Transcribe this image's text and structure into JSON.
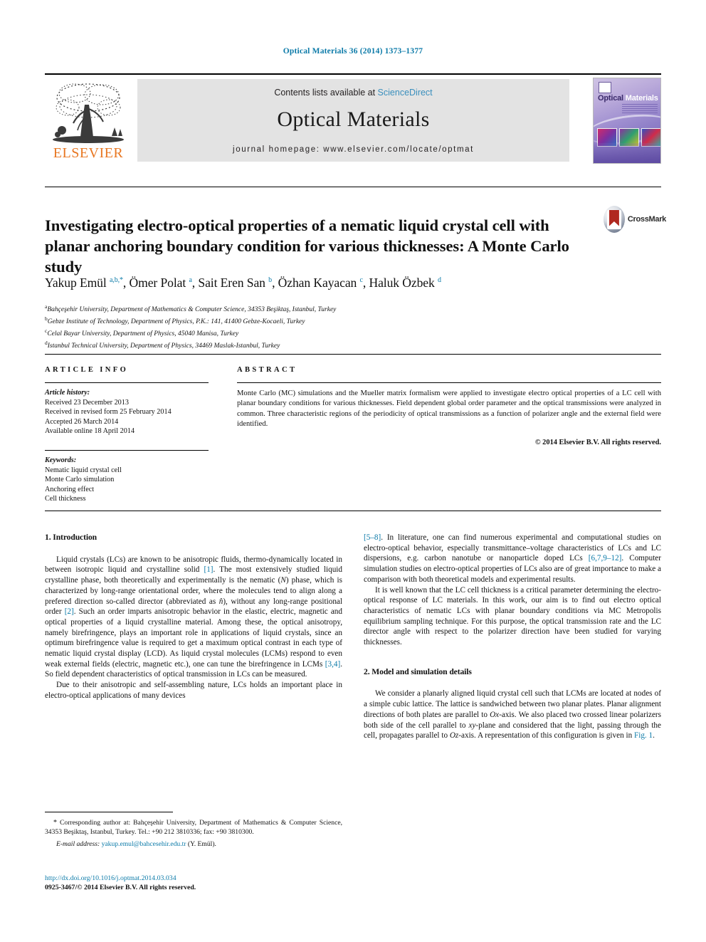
{
  "running_head": "Optical Materials 36 (2014) 1373–1377",
  "masthead": {
    "publisher_name": "ELSEVIER",
    "contents_prefix": "Contents lists available at ",
    "contents_link": "ScienceDirect",
    "journal_title": "Optical Materials",
    "homepage": "journal homepage: www.elsevier.com/locate/optmat",
    "cover_title_a": "Optical",
    "cover_title_b": "Materials"
  },
  "crossmark": {
    "label": "CrossMark"
  },
  "article": {
    "title": "Investigating electro-optical properties of a nematic liquid crystal cell with planar anchoring boundary condition for various thicknesses: A Monte Carlo study",
    "authors_html": "Yakup Emül <sup>a,b,*</sup>, Ömer Polat <sup>a</sup>, Sait Eren San <sup>b</sup>, Özhan Kayacan <sup>c</sup>, Haluk Özbek <sup>d</sup>",
    "affiliations": [
      "Bahçeşehir University, Department of Mathematics & Computer Science, 34353 Beşiktaş, Istanbul, Turkey",
      "Gebze Institute of Technology, Department of Physics, P.K.: 141, 41400 Gebze-Kocaeli, Turkey",
      "Celal Bayar University, Department of Physics, 45040 Manisa, Turkey",
      "Istanbul Technical University, Department of Physics, 34469 Maslak-Istanbul, Turkey"
    ],
    "affiliation_marks": [
      "a",
      "b",
      "c",
      "d"
    ]
  },
  "info": {
    "heading": "ARTICLE INFO",
    "history_title": "Article history:",
    "history": [
      "Received 23 December 2013",
      "Received in revised form 25 February 2014",
      "Accepted 26 March 2014",
      "Available online 18 April 2014"
    ],
    "keywords_title": "Keywords:",
    "keywords": [
      "Nematic liquid crystal cell",
      "Monte Carlo simulation",
      "Anchoring effect",
      "Cell thickness"
    ]
  },
  "abstract": {
    "heading": "ABSTRACT",
    "text": "Monte Carlo (MC) simulations and the Mueller matrix formalism were applied to investigate electro optical properties of a LC cell with planar boundary conditions for various thicknesses. Field dependent global order parameter and the optical transmissions were analyzed in common. Three characteristic regions of the periodicity of optical transmissions as a function of polarizer angle and the external field were identified.",
    "copyright": "© 2014 Elsevier B.V. All rights reserved."
  },
  "sections": {
    "intro_heading": "1. Introduction",
    "model_heading": "2. Model and simulation details"
  },
  "body": {
    "left": {
      "p1_a": "Liquid crystals (LCs) are known to be anisotropic fluids, thermo-dynamically located in between isotropic liquid and crystalline solid ",
      "p1_ref1": "[1]",
      "p1_b": ". The most extensively studied liquid crystalline phase, both theoretically and experimentally is the nematic (",
      "p1_n": "N",
      "p1_c": ") phase, which is characterized by long-range orientational order, where the molecules tend to align along a prefered direction so-called director (abbreviated as ",
      "p1_nhat": "n̂",
      "p1_d": "), without any long-range positional order ",
      "p1_ref2": "[2]",
      "p1_e": ". Such an order imparts anisotropic behavior in the elastic, electric, magnetic and optical properties of a liquid crystalline material. Among these, the optical anisotropy, namely birefringence, plays an important role in applications of liquid crystals, since an optimum birefringence value is required to get a maximum optical contrast in each type of nematic liquid crystal display (LCD). As liquid crystal molecules (LCMs) respond to even weak external fields (electric, magnetic etc.), one can tune the birefringence in LCMs ",
      "p1_ref3": "[3,4]",
      "p1_f": ". So field dependent characteristics of optical transmission in LCs can be measured.",
      "p2": "Due to their anisotropic and self-assembling nature, LCs holds an important place in electro-optical applications of many devices"
    },
    "right": {
      "p1_ref1": "[5–8]",
      "p1_a": ". In literature, one can find numerous experimental and computational studies on electro-optical behavior, especially transmittance–voltage characteristics of LCs and LC dispersions, e.g. carbon nanotube or nanoparticle doped LCs ",
      "p1_ref2": "[6,7,9–12]",
      "p1_b": ". Computer simulation studies on electro-optical properties of LCs also are of great importance to make a comparison with both theoretical models and experimental results.",
      "p2": "It is well known that the LC cell thickness is a critical parameter determining the electro-optical response of LC materials. In this work, our aim is to find out electro optical characteristics of nematic LCs with planar boundary conditions via MC Metropolis equilibrium sampling technique. For this purpose, the optical transmission rate and the LC director angle with respect to the polarizer direction have been studied for varying thicknesses.",
      "p3_a": "We consider a planarly aligned liquid crystal cell such that LCMs are located at nodes of a simple cubic lattice. The lattice is sandwiched between two planar plates. Planar alignment directions of both plates are parallel to ",
      "p3_ox": "Ox",
      "p3_b": "-axis. We also placed two crossed linear polarizers both side of the cell parallel to ",
      "p3_xy": "xy",
      "p3_c": "-plane and considered that the light, passing through the cell, propagates parallel to ",
      "p3_oz": "Oz",
      "p3_d": "-axis. A representation of this configuration is given in ",
      "p3_fig": "Fig. 1",
      "p3_e": "."
    }
  },
  "footnote": {
    "star": "*",
    "corresponding": "Corresponding author at: Bahçeşehir University, Department of Mathematics & Computer Science, 34353 Beşiktaş, Istanbul, Turkey. Tel.: +90 212 3810336; fax: +90 3810300.",
    "email_label": "E-mail address:",
    "email": "yakup.emul@bahcesehir.edu.tr",
    "email_owner": "(Y. Emül)."
  },
  "doi_block": {
    "doi_url": "http://dx.doi.org/10.1016/j.optmat.2014.03.034",
    "issn_line": "0925-3467/© 2014 Elsevier B.V. All rights reserved."
  },
  "colors": {
    "link": "#0b7aa8",
    "elsevier_orange": "#E87722",
    "band_grey": "#e3e3e3"
  }
}
